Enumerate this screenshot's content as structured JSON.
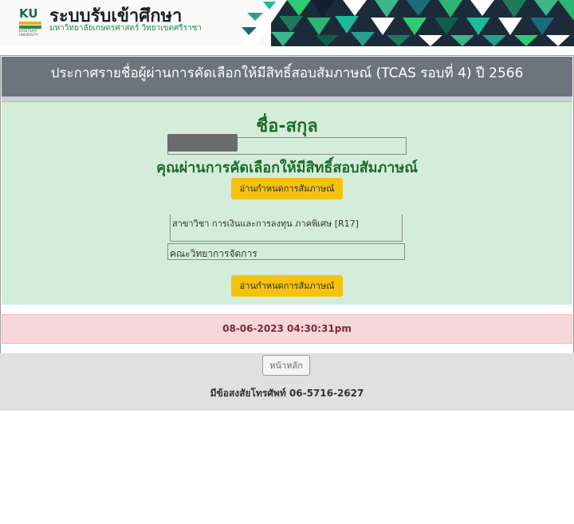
{
  "header": {
    "logo_text": "KU",
    "logo_small": "KASETSART UNIVERSITY",
    "brand_title": "ระบบรับเข้าศึกษา",
    "brand_subtitle": "มหาวิทยาลัยเกษตรศาสตร์ วิทยาเขตศรีราชา"
  },
  "announcement": {
    "title": "ประกาศรายชื่อผู้ผ่านการคัดเลือกให้มีสิทธิ์สอบสัมภาษณ์ (TCAS รอบที่ 4) ปี 2566"
  },
  "result": {
    "name_label": "ชื่อ-สกุล",
    "name_value": "",
    "pass_message": "คุณผ่านการคัดเลือกให้มีสิทธิ์สอบสัมภาษณ์",
    "read_button_label": "อ่านกำหนดการสัมภาษณ์",
    "major": "สาขาวิชา การเงินและการลงทุน ภาคพิเศษ [R17]",
    "faculty": "คณะวิทยาการจัดการ",
    "read_button_label_2": "อ่านกำหนดการสัมภาษณ์"
  },
  "timestamp": "08-06-2023 04:30:31pm",
  "footer": {
    "home_button": "หน้าหลัก",
    "contact": "มีข้อสงสัยโทรศัพท์ 06-5716-2627"
  },
  "colors": {
    "title_bar": "#6c757d",
    "success_bg": "#d4edda",
    "success_text": "#1d6b2d",
    "warning_button": "#f7c20d",
    "danger_bg": "#f8d7da",
    "danger_text": "#7a2a34",
    "footer_bg": "#e0e0e0"
  }
}
